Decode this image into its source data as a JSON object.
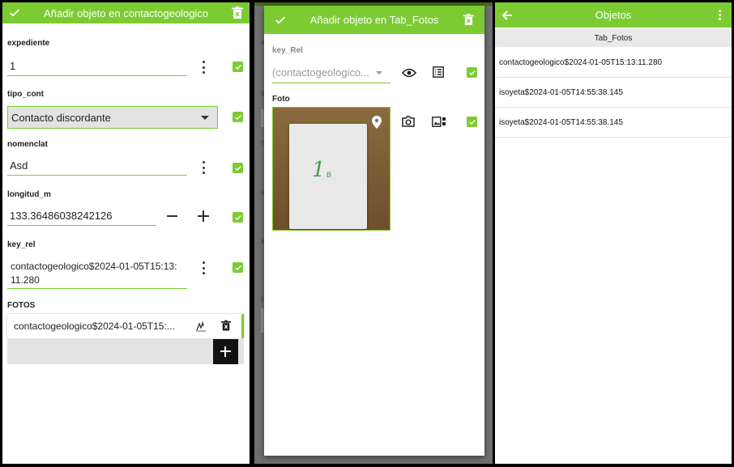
{
  "panel1": {
    "title": "Añadir objeto en contactogeologico",
    "fields": {
      "expediente": {
        "label": "expediente",
        "value": "1"
      },
      "tipo_cont": {
        "label": "tipo_cont",
        "value": "Contacto discordante"
      },
      "nomenclat": {
        "label": "nomenclat",
        "value": "Asd"
      },
      "longitud_m": {
        "label": "longitud_m",
        "value": "133.36486038242126"
      },
      "key_rel": {
        "label": "key_rel",
        "value_line1": "contactogeologico$2024-01-05T15:13:",
        "value_line2": "11.280"
      }
    },
    "fotos": {
      "label": "FOTOS",
      "item": "contactogeologico$2024-01-05T15:..."
    }
  },
  "panel2": {
    "title": "Añadir objeto en Tab_Fotos",
    "key_rel": {
      "label": "key_Rel",
      "placeholder": "(contactogeologico..."
    },
    "foto": {
      "label": "Foto",
      "photo_text": "1",
      "photo_sub": "B"
    }
  },
  "panel3": {
    "title": "Objetos",
    "section": "Tab_Fotos",
    "items": [
      "contactogeologico$2024-01-05T15:13:11.280",
      "isoyeta$2024-01-05T14:55:38.145",
      "isoyeta$2024-01-05T14:55:38.145"
    ]
  },
  "colors": {
    "accent": "#7ccb33",
    "dim_overlay": "#6f6f6f"
  }
}
